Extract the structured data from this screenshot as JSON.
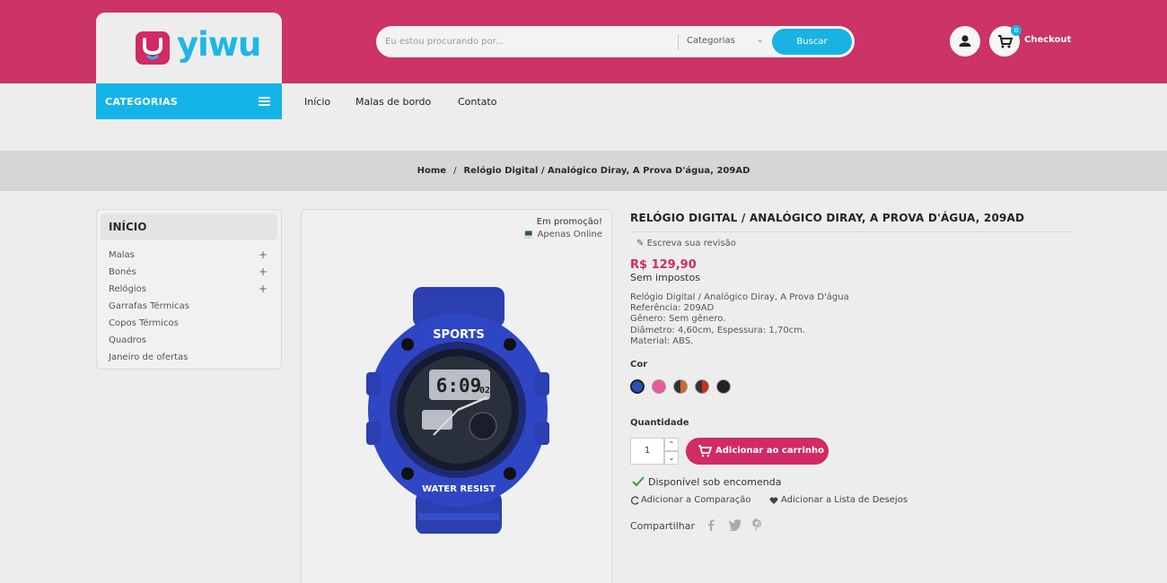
{
  "header": {
    "logo_text": "yiwu",
    "search_placeholder": "Eu estou procurando por...",
    "search_category": "Categorias",
    "search_button": "Buscar",
    "cart_count": "0",
    "checkout_label": "Checkout"
  },
  "nav": {
    "categories_label": "CATEGORIAS",
    "items": [
      "Início",
      "Malas de bordo",
      "Contato"
    ]
  },
  "breadcrumb": {
    "home": "Home",
    "separator": "/",
    "current": "Relógio Digital / Analógico Diray, A Prova D'água, 209AD"
  },
  "sidebar": {
    "title": "INÍCIO",
    "items": [
      {
        "label": "Malas",
        "expandable": true
      },
      {
        "label": "Bonés",
        "expandable": true
      },
      {
        "label": "Relógios",
        "expandable": true
      },
      {
        "label": "Garrafas Térmicas",
        "expandable": false
      },
      {
        "label": "Copos Térmicos",
        "expandable": false
      },
      {
        "label": "Quadros",
        "expandable": false
      },
      {
        "label": "Janeiro de ofertas",
        "expandable": false
      }
    ],
    "plus_symbol": "+"
  },
  "image_panel": {
    "promo_flag": "Em promoção!",
    "online_flag": "Apenas Online",
    "watch_text_top": "SPORTS",
    "watch_text_bottom": "WATER RESIST",
    "watch_time": "6:09",
    "watch_seconds": "02"
  },
  "product": {
    "title": "RELÓGIO DIGITAL / ANALÓGICO DIRAY, A PROVA D'ÁGUA, 209AD",
    "review_link": "Escreva sua revisão",
    "price": "R$ 129,90",
    "tax_label": "Sem impostos",
    "description": [
      "Relógio Digital / Analógico Diray, A Prova D'água",
      "Referência: 209AD",
      "Gênero: Sem gênero.",
      "Diâmetro: 4,60cm, Espessura: 1,70cm.",
      "Material: ABS."
    ],
    "color_label": "Cor",
    "colors": [
      "#2a4fb8",
      "#e85a9a",
      "#7a4a2a",
      "#c8321e",
      "#222222"
    ],
    "quantity_label": "Quantidade",
    "quantity_value": "1",
    "add_to_cart": "Adicionar ao carrinho",
    "availability": "Disponível sob encomenda",
    "compare_link": "Adicionar a Comparação",
    "wishlist_link": "Adicionar a Lista de Desejos",
    "share_label": "Compartilhar"
  },
  "colors": {
    "brand_pink": "#cc3366",
    "accent_blue": "#19b2e3",
    "price_pink": "#d12a64"
  }
}
